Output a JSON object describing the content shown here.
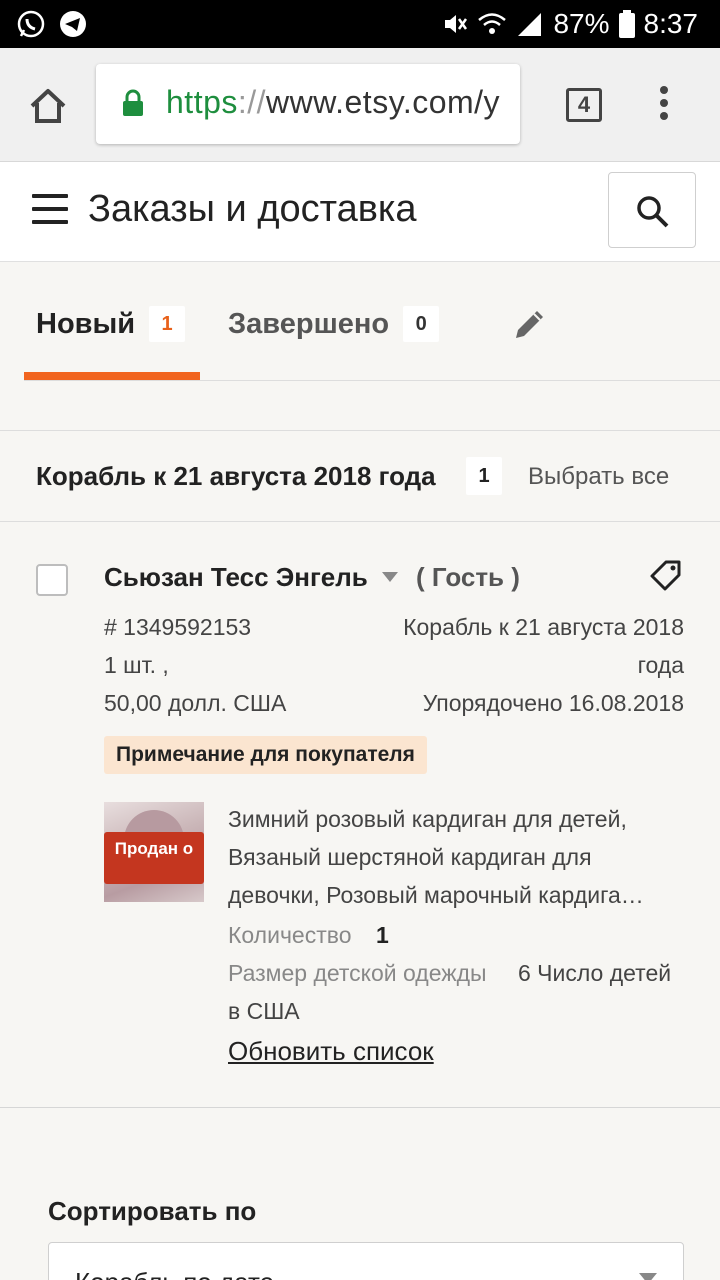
{
  "status_bar": {
    "battery": "87%",
    "time": "8:37",
    "icons": [
      "whatsapp-icon",
      "telegram-icon",
      "mute-icon",
      "wifi-icon",
      "signal-icon",
      "battery-icon"
    ]
  },
  "browser": {
    "url_scheme": "https",
    "url_sep": "://",
    "url_host": "www.etsy.com/y",
    "tab_count": "4"
  },
  "header": {
    "title": "Заказы и доставка"
  },
  "tabs": [
    {
      "label": "Новый",
      "count": "1",
      "active": true
    },
    {
      "label": "Завершено",
      "count": "0",
      "active": false
    }
  ],
  "group": {
    "title": "Корабль к 21 августа 2018 года",
    "count": "1",
    "select_all": "Выбрать все"
  },
  "order": {
    "buyer": "Сьюзан Тесс Энгель",
    "guest": "( Гость )",
    "number": "# 1349592153",
    "quantity_line": "1 шт. ,",
    "price": "50,00 долл. США",
    "ship_by_line1": "Корабль к 21 августа 2018",
    "ship_by_line2": "года",
    "ordered": "Упорядочено 16.08.2018",
    "note_badge": "Примечание для покупателя",
    "sold_badge": "Продан о",
    "product_title": "Зимний розовый кардиган для детей, Вязаный шерстяной кардиган для девочки, Розовый марочный кардига…",
    "qty_label": "Количество",
    "qty_value": "1",
    "size_label": "Размер детской одежды",
    "size_value": "6 Число детей",
    "size_value_cont": "в США",
    "update_link": "Обновить список"
  },
  "sort": {
    "label": "Сортировать по",
    "value": "Корабль по дате"
  },
  "colors": {
    "accent": "#f1641e",
    "sold": "#c4361f",
    "note_bg": "#fbe5d0",
    "secure": "#1e8e3e"
  }
}
